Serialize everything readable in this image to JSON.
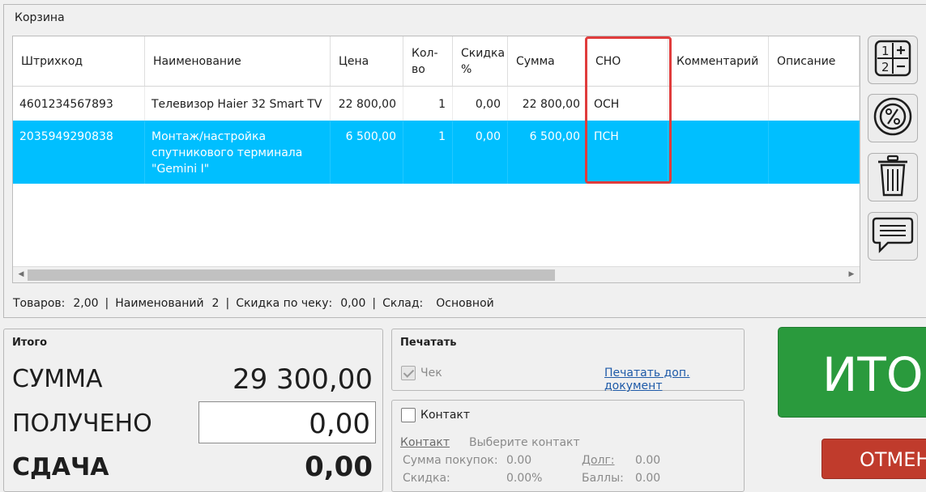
{
  "cart": {
    "title": "Корзина",
    "columns": [
      "Штрихкод",
      "Наименование",
      "Цена",
      "Кол-\nво",
      "Скидка\n%",
      "Сумма",
      "СНО",
      "Комментарий",
      "Описание"
    ],
    "rows": [
      {
        "barcode": "4601234567893",
        "name": "Телевизор Haier 32 Smart TV",
        "price": "22 800,00",
        "qty": "1",
        "discount": "0,00",
        "sum": "22 800,00",
        "cno": "ОСН",
        "comment": "",
        "description": ""
      },
      {
        "barcode": "2035949290838",
        "name": "Монтаж/настройка\nспутникового терминала\n\"Gemini I\"",
        "price": "6 500,00",
        "qty": "1",
        "discount": "0,00",
        "sum": "6 500,00",
        "cno": "ПСН",
        "comment": "",
        "description": ""
      }
    ],
    "selected_row_color": "#00bfff",
    "highlight_color": "#e03c3c"
  },
  "status": {
    "goods_label": "Товаров:",
    "goods_value": "2,00",
    "names_label": "Наименований",
    "names_value": "2",
    "discount_label": "Скидка по чеку:",
    "discount_value": "0,00",
    "warehouse_label": "Склад:",
    "warehouse_value": "Основной",
    "sep": "|"
  },
  "side_buttons": [
    "calculator-icon",
    "percent-icon",
    "trash-icon",
    "comment-icon"
  ],
  "totals": {
    "title": "Итого",
    "sum_label": "СУММА",
    "sum_value": "29 300,00",
    "received_label": "ПОЛУЧЕНО",
    "received_value": "0,00",
    "change_label": "СДАЧА",
    "change_value": "0,00"
  },
  "print": {
    "title": "Печатать",
    "check_label": "Чек",
    "check_checked": true,
    "extra_doc_link": "Печатать доп. документ"
  },
  "contact": {
    "checkbox_label": "Контакт",
    "contact_link": "Контакт",
    "contact_placeholder": "Выберите контакт",
    "purchases_label": "Сумма покупок:",
    "purchases_value": "0.00",
    "debt_label": "Долг:",
    "debt_value": "0.00",
    "discount_label": "Скидка:",
    "discount_value": "0.00%",
    "points_label": "Баллы:",
    "points_value": "0.00"
  },
  "actions": {
    "total_button": "ИТОГ",
    "cancel_button": "ОТМЕНА",
    "total_color": "#2a9a3d",
    "cancel_color": "#c03b2c"
  }
}
